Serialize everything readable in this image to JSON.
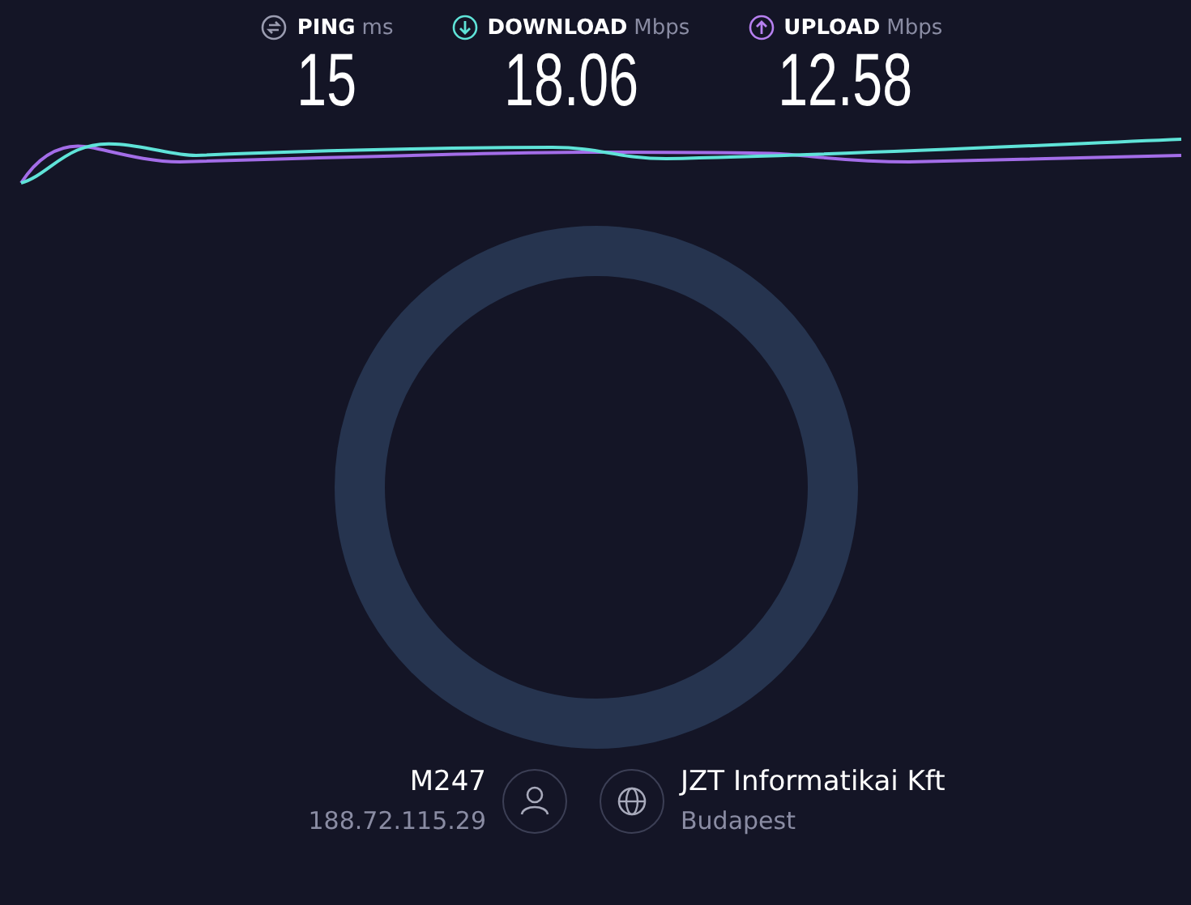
{
  "metrics": [
    {
      "kind": "ping",
      "label": "PING",
      "unit": "ms",
      "value": "15",
      "color": "#9a9cb0"
    },
    {
      "kind": "download",
      "label": "DOWNLOAD",
      "unit": "Mbps",
      "value": "18.06",
      "color": "#5fe3d8"
    },
    {
      "kind": "upload",
      "label": "UPLOAD",
      "unit": "Mbps",
      "value": "12.58",
      "color": "#b780f0"
    }
  ],
  "client": {
    "isp": "M247",
    "ip": "188.72.115.29"
  },
  "server": {
    "name": "JZT Informatikai Kft",
    "location": "Budapest"
  }
}
